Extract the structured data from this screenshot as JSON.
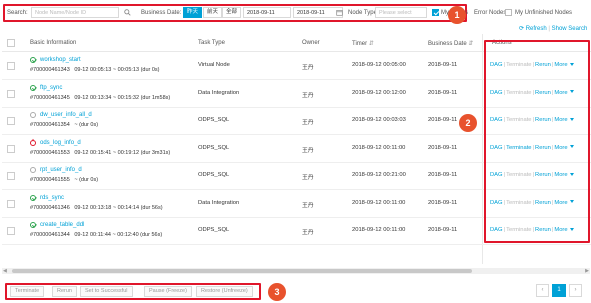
{
  "filter": {
    "search_label": "Search:",
    "search_placeholder": "Node Name/Node ID",
    "business_date_label": "Business Date:",
    "date_chips": [
      "昨天",
      "前天",
      "全部"
    ],
    "date_from": "2018-09-11",
    "date_to": "2018-09-11",
    "node_type_label": "Node Type:",
    "node_type_placeholder": "Please select",
    "my_nodes_label": "My Nodes",
    "error_nodes_label": "Error Nodes",
    "unfinished_label": "My Unfinished Nodes"
  },
  "toolbar": {
    "refresh_label": "Refresh",
    "show_search_label": "Show Search"
  },
  "table": {
    "headers": {
      "basic_info": "Basic Information",
      "task_type": "Task Type",
      "owner": "Owner",
      "timer": "Timer",
      "business_date": "Business Date",
      "actions": "Actions"
    },
    "rows": [
      {
        "status": "ok",
        "name": "workshop_start",
        "id": "#700000461343",
        "time_range": "09-12 00:05:13 ~ 00:05:13 (dur 0s)",
        "task_type": "Virtual Node",
        "owner": "王丹",
        "timer": "2018-09-12 00:05:00",
        "business_date": "2018-09-11",
        "enabled": false
      },
      {
        "status": "ok",
        "name": "ftp_sync",
        "id": "#700000461345",
        "time_range": "09-12 00:13:34 ~ 00:15:32 (dur 1m58s)",
        "task_type": "Data Integration",
        "owner": "王丹",
        "timer": "2018-09-12 00:12:00",
        "business_date": "2018-09-11",
        "enabled": false
      },
      {
        "status": "wait",
        "name": "dw_user_info_all_d",
        "id": "#700000461354",
        "time_range": "~ (dur 0s)",
        "task_type": "ODPS_SQL",
        "owner": "王丹",
        "timer": "2018-09-12 00:03:03",
        "business_date": "2018-09-11",
        "enabled": false
      },
      {
        "status": "err",
        "name": "ods_log_info_d",
        "id": "#700000461553",
        "time_range": "09-12 00:15:41 ~ 00:19:12 (dur 3m31s)",
        "task_type": "ODPS_SQL",
        "owner": "王丹",
        "timer": "2018-09-12 00:11:00",
        "business_date": "2018-09-11",
        "enabled": true
      },
      {
        "status": "wait",
        "name": "rpt_user_info_d",
        "id": "#700000461555",
        "time_range": "~ (dur 0s)",
        "task_type": "ODPS_SQL",
        "owner": "王丹",
        "timer": "2018-09-12 00:21:00",
        "business_date": "2018-09-11",
        "enabled": false
      },
      {
        "status": "ok",
        "name": "rds_sync",
        "id": "#700000461346",
        "time_range": "09-12 00:13:18 ~ 00:14:14 (dur 56s)",
        "task_type": "Data Integration",
        "owner": "王丹",
        "timer": "2018-09-12 00:11:00",
        "business_date": "2018-09-11",
        "enabled": false
      },
      {
        "status": "ok",
        "name": "create_table_ddl",
        "id": "#700000461344",
        "time_range": "09-12 00:11:44 ~ 00:12:40 (dur 56s)",
        "task_type": "ODPS_SQL",
        "owner": "王丹",
        "timer": "2018-09-12 00:11:00",
        "business_date": "2018-09-11",
        "enabled": false
      }
    ],
    "action_labels": {
      "dag": "DAG",
      "terminate": "Terminate",
      "rerun": "Rerun",
      "more": "More"
    }
  },
  "bulk_actions": [
    "Terminate",
    "Rerun",
    "Set to Successful",
    "Pause (Freeze)",
    "Restore (Unfreeze)"
  ],
  "pagination": {
    "prev": "‹",
    "current": "1",
    "next": "›"
  },
  "callouts": [
    "1",
    "2",
    "3"
  ],
  "colors": {
    "accent": "#00a1d6",
    "highlight": "#e0162b",
    "callout": "#e8522d",
    "success": "#2ba24c"
  }
}
